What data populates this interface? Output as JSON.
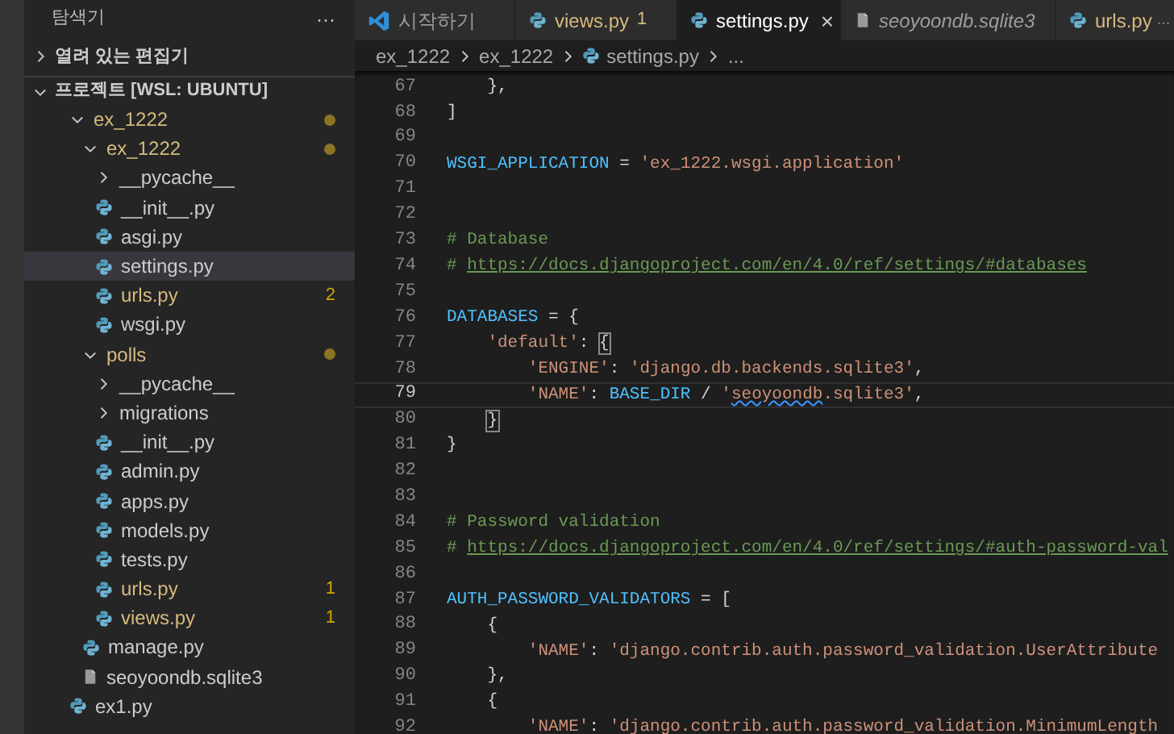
{
  "sidebar": {
    "title": "탐색기",
    "more": "···",
    "open_editors": {
      "label": "열려 있는 편집기",
      "expanded": false
    },
    "project": {
      "label": "프로젝트 [WSL: UBUNTU]",
      "expanded": true
    },
    "tree": [
      {
        "name": "ex_1222",
        "kind": "folder",
        "expanded": true,
        "modified": true,
        "dot": true,
        "selected": false,
        "children": [
          {
            "name": "ex_1222",
            "kind": "folder",
            "expanded": true,
            "modified": true,
            "dot": true,
            "selected": false,
            "children": [
              {
                "name": "__pycache__",
                "kind": "folder",
                "expanded": false,
                "modified": false,
                "selected": false
              },
              {
                "name": "__init__.py",
                "kind": "python",
                "modified": false,
                "selected": false
              },
              {
                "name": "asgi.py",
                "kind": "python",
                "modified": false,
                "selected": false
              },
              {
                "name": "settings.py",
                "kind": "python",
                "modified": false,
                "selected": true
              },
              {
                "name": "urls.py",
                "kind": "python",
                "modified": true,
                "badge": "2",
                "selected": false
              },
              {
                "name": "wsgi.py",
                "kind": "python",
                "modified": false,
                "selected": false
              }
            ]
          },
          {
            "name": "polls",
            "kind": "folder",
            "expanded": true,
            "modified": true,
            "dot": true,
            "selected": false,
            "children": [
              {
                "name": "__pycache__",
                "kind": "folder",
                "expanded": false,
                "modified": false,
                "selected": false
              },
              {
                "name": "migrations",
                "kind": "folder",
                "expanded": false,
                "modified": false,
                "selected": false
              },
              {
                "name": "__init__.py",
                "kind": "python",
                "modified": false,
                "selected": false
              },
              {
                "name": "admin.py",
                "kind": "python",
                "modified": false,
                "selected": false
              },
              {
                "name": "apps.py",
                "kind": "python",
                "modified": false,
                "selected": false
              },
              {
                "name": "models.py",
                "kind": "python",
                "modified": false,
                "selected": false
              },
              {
                "name": "tests.py",
                "kind": "python",
                "modified": false,
                "selected": false
              },
              {
                "name": "urls.py",
                "kind": "python",
                "modified": true,
                "badge": "1",
                "selected": false
              },
              {
                "name": "views.py",
                "kind": "python",
                "modified": true,
                "badge": "1",
                "selected": false
              }
            ]
          },
          {
            "name": "manage.py",
            "kind": "python",
            "modified": false,
            "selected": false
          },
          {
            "name": "seoyoondb.sqlite3",
            "kind": "file",
            "modified": false,
            "selected": false
          }
        ]
      },
      {
        "name": "ex1.py",
        "kind": "python",
        "modified": false,
        "selected": false
      }
    ]
  },
  "tabs": [
    {
      "label": "시작하기",
      "kind": "welcome",
      "selected": false,
      "modified": false,
      "italic": false
    },
    {
      "label": "views.py",
      "kind": "python",
      "selected": false,
      "modified": true,
      "badge": "1",
      "italic": false
    },
    {
      "label": "settings.py",
      "kind": "python",
      "selected": true,
      "modified": false,
      "italic": false,
      "close": "×"
    },
    {
      "label": "seoyoondb.sqlite3",
      "kind": "file",
      "selected": false,
      "modified": false,
      "italic": true
    },
    {
      "label": "urls.py",
      "kind": "python",
      "selected": false,
      "modified": true,
      "italic": false,
      "description": "..."
    }
  ],
  "breadcrumb": [
    {
      "label": "ex_1222",
      "kind": "folder"
    },
    {
      "label": "ex_1222",
      "kind": "folder"
    },
    {
      "label": "settings.py",
      "kind": "python"
    },
    {
      "label": "...",
      "kind": "symbol"
    }
  ],
  "code": [
    {
      "number": "67",
      "current": false,
      "tokens": [
        {
          "kind": "plain",
          "text": "    },"
        }
      ]
    },
    {
      "number": "68",
      "current": false,
      "tokens": [
        {
          "kind": "plain",
          "text": "]"
        }
      ]
    },
    {
      "number": "69",
      "current": false
    },
    {
      "number": "70",
      "current": false,
      "tokens": [
        {
          "kind": "var",
          "text": "WSGI_APPLICATION"
        },
        {
          "kind": "plain",
          "text": " = "
        },
        {
          "kind": "str",
          "text": "'ex_1222.wsgi.application'"
        }
      ]
    },
    {
      "number": "71",
      "current": false
    },
    {
      "number": "72",
      "current": false
    },
    {
      "number": "73",
      "current": false,
      "tokens": [
        {
          "kind": "comment",
          "text": "# Database"
        }
      ]
    },
    {
      "number": "74",
      "current": false,
      "tokens": [
        {
          "kind": "comment",
          "text": "# "
        },
        {
          "kind": "link",
          "text": "https://docs.djangoproject.com/en/4.0/ref/settings/#databases"
        }
      ]
    },
    {
      "number": "75",
      "current": false
    },
    {
      "number": "76",
      "current": false,
      "tokens": [
        {
          "kind": "var",
          "text": "DATABASES"
        },
        {
          "kind": "plain",
          "text": " = {"
        }
      ]
    },
    {
      "number": "77",
      "current": false,
      "tokens": [
        {
          "kind": "str",
          "text": "    'default'"
        },
        {
          "kind": "plain",
          "text": ": "
        },
        {
          "kind": "bracket",
          "text": "{"
        }
      ]
    },
    {
      "number": "78",
      "current": false,
      "tokens": [
        {
          "kind": "str",
          "text": "        'ENGINE'"
        },
        {
          "kind": "plain",
          "text": ": "
        },
        {
          "kind": "str",
          "text": "'django.db.backends.sqlite3'"
        },
        {
          "kind": "plain",
          "text": ","
        }
      ]
    },
    {
      "number": "79",
      "current": true,
      "tokens": [
        {
          "kind": "str",
          "text": "        'NAME'"
        },
        {
          "kind": "plain",
          "text": ": "
        },
        {
          "kind": "var",
          "text": "BASE_DIR"
        },
        {
          "kind": "plain",
          "text": " / "
        },
        {
          "kind": "str",
          "text": "'"
        },
        {
          "kind": "squiggle",
          "text": "seoyoondb"
        },
        {
          "kind": "str",
          "text": ".sqlite3'"
        },
        {
          "kind": "plain",
          "text": ","
        }
      ]
    },
    {
      "number": "80",
      "current": false,
      "tokens": [
        {
          "kind": "bracket",
          "text": "    }"
        }
      ]
    },
    {
      "number": "81",
      "current": false,
      "tokens": [
        {
          "kind": "plain",
          "text": "}"
        }
      ]
    },
    {
      "number": "82",
      "current": false
    },
    {
      "number": "83",
      "current": false
    },
    {
      "number": "84",
      "current": false,
      "tokens": [
        {
          "kind": "comment",
          "text": "# Password validation"
        }
      ]
    },
    {
      "number": "85",
      "current": false,
      "tokens": [
        {
          "kind": "comment",
          "text": "# "
        },
        {
          "kind": "link",
          "text": "https://docs.djangoproject.com/en/4.0/ref/settings/#auth-password-val"
        }
      ]
    },
    {
      "number": "86",
      "current": false
    },
    {
      "number": "87",
      "current": false,
      "tokens": [
        {
          "kind": "var",
          "text": "AUTH_PASSWORD_VALIDATORS"
        },
        {
          "kind": "plain",
          "text": " = ["
        }
      ]
    },
    {
      "number": "88",
      "current": false,
      "tokens": [
        {
          "kind": "plain",
          "text": "    {"
        }
      ]
    },
    {
      "number": "89",
      "current": false,
      "tokens": [
        {
          "kind": "str",
          "text": "        'NAME'"
        },
        {
          "kind": "plain",
          "text": ": "
        },
        {
          "kind": "str",
          "text": "'django.contrib.auth.password_validation.UserAttribute"
        }
      ]
    },
    {
      "number": "90",
      "current": false,
      "tokens": [
        {
          "kind": "plain",
          "text": "    },"
        }
      ]
    },
    {
      "number": "91",
      "current": false,
      "tokens": [
        {
          "kind": "plain",
          "text": "    {"
        }
      ]
    },
    {
      "number": "92",
      "current": false,
      "tokens": [
        {
          "kind": "str",
          "text": "        'NAME'"
        },
        {
          "kind": "plain",
          "text": ": "
        },
        {
          "kind": "str",
          "text": "'django.contrib.auth.password_validation.MinimumLength"
        }
      ]
    }
  ]
}
